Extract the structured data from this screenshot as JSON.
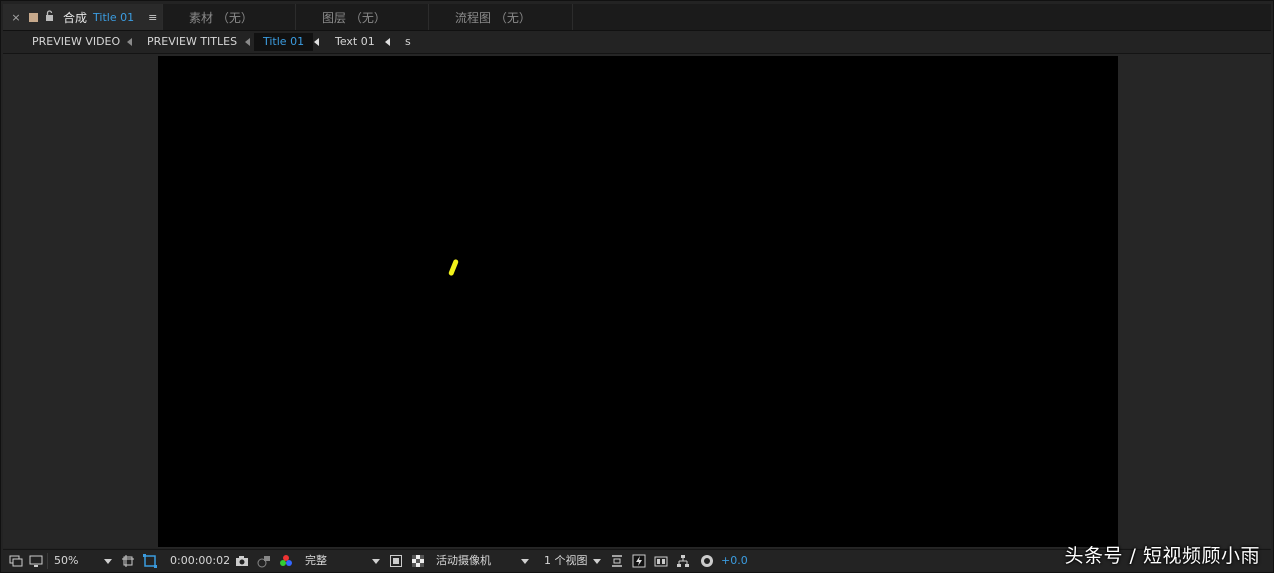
{
  "tabs": [
    {
      "label": "合成",
      "name": "Title 01",
      "active": true
    },
    {
      "label": "素材 （无）"
    },
    {
      "label": "图层 （无）"
    },
    {
      "label": "流程图 （无）"
    }
  ],
  "tab_icons": {
    "close": "×",
    "menu": "≡"
  },
  "breadcrumbs": [
    "PREVIEW VIDEO",
    "PREVIEW TITLES",
    "Title 01",
    "Text 01",
    "s"
  ],
  "toolbar": {
    "zoom": "50%",
    "timecode": "0:00:00:02",
    "resolution": "完整",
    "camera": "活动摄像机",
    "views": "1 个视图",
    "exposure": "+0.0"
  },
  "colors": {
    "accent": "#3b9ce0",
    "mark": "#f2f21a",
    "swatch": "#c7a98c"
  },
  "watermark": "头条号 / 短视频顾小雨"
}
